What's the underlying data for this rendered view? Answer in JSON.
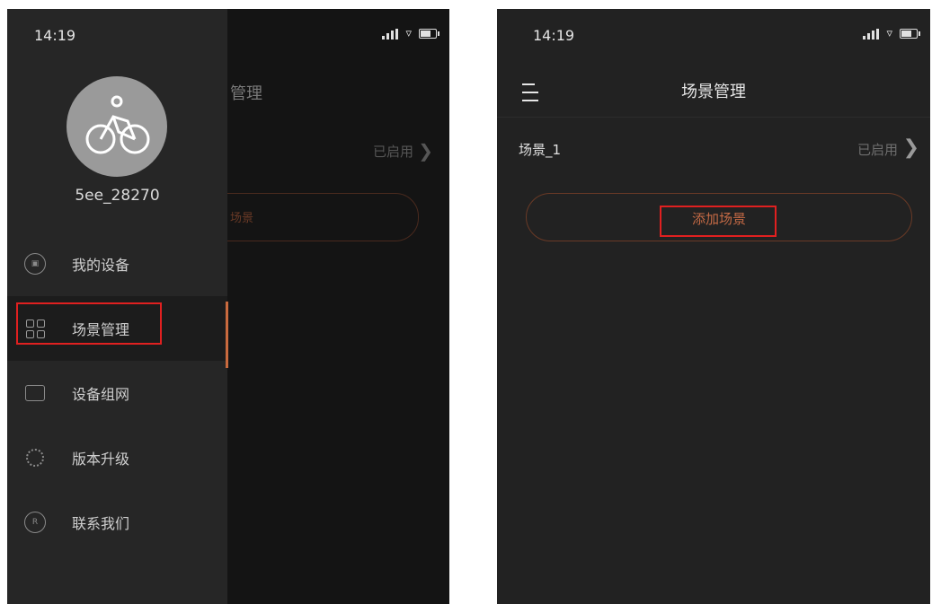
{
  "left_screen": {
    "time": "14:19",
    "back": {
      "title": "管理",
      "status": "已启用",
      "add_label": "场景"
    },
    "drawer": {
      "username": "5ee_28270",
      "menu": [
        {
          "label": "我的设备",
          "icon": "device-icon"
        },
        {
          "label": "场景管理",
          "icon": "scene-grid-icon",
          "active": true
        },
        {
          "label": "设备组网",
          "icon": "network-icon"
        },
        {
          "label": "版本升级",
          "icon": "upgrade-icon"
        },
        {
          "label": "联系我们",
          "icon": "contact-icon"
        }
      ]
    }
  },
  "right_screen": {
    "time": "14:19",
    "title": "场景管理",
    "scene": {
      "name": "场景_1",
      "status": "已启用"
    },
    "add_button": "添加场景"
  },
  "colors": {
    "accent": "#c96a3e",
    "highlight": "#e02020",
    "background": "#222222"
  }
}
